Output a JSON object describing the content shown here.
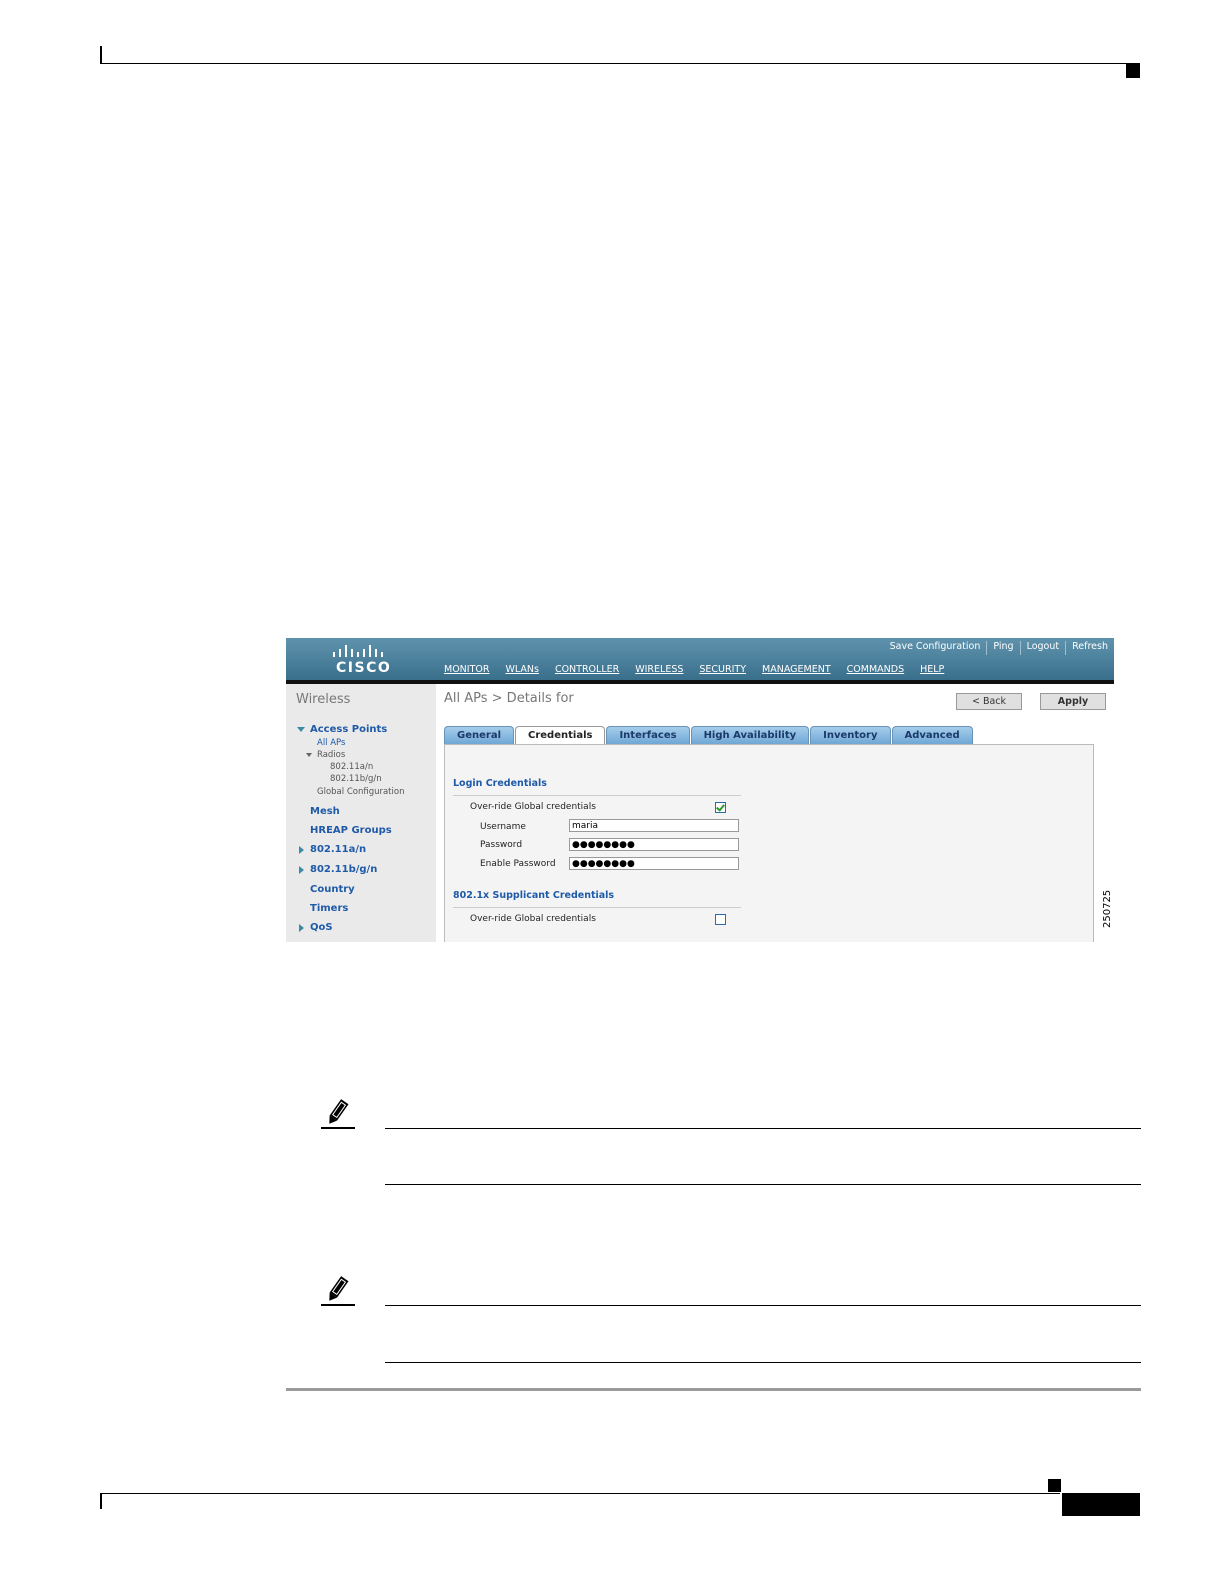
{
  "screenshot": {
    "logo_text": "CISCO",
    "top_links": [
      "Save Configuration",
      "Ping",
      "Logout",
      "Refresh"
    ],
    "menu": [
      "MONITOR",
      "WLANs",
      "CONTROLLER",
      "WIRELESS",
      "SECURITY",
      "MANAGEMENT",
      "COMMANDS",
      "HELP"
    ],
    "active_menu": "WIRELESS",
    "sidebar": {
      "title": "Wireless",
      "access_points": "Access Points",
      "all_aps": "All APs",
      "radios": "Radios",
      "radio_a": "802.11a/n",
      "radio_b": "802.11b/g/n",
      "global_config": "Global Configuration",
      "mesh": "Mesh",
      "hreap": "HREAP Groups",
      "band_a": "802.11a/n",
      "band_b": "802.11b/g/n",
      "country": "Country",
      "timers": "Timers",
      "qos": "QoS"
    },
    "page_title": "All APs > Details for",
    "back_button": "< Back",
    "apply_button": "Apply",
    "tabs": [
      "General",
      "Credentials",
      "Interfaces",
      "High Availability",
      "Inventory",
      "Advanced"
    ],
    "active_tab": "Credentials",
    "login_section": {
      "heading": "Login Credentials",
      "override_label": "Over-ride Global credentials",
      "override_checked": true,
      "username_label": "Username",
      "username_value": "maria",
      "password_label": "Password",
      "password_value": "●●●●●●●●",
      "enable_label": "Enable Password",
      "enable_value": "●●●●●●●●"
    },
    "supplicant_section": {
      "heading": "802.1x Supplicant Credentials",
      "override_label": "Over-ride Global credentials",
      "override_checked": false
    }
  },
  "figure_id": "250725",
  "colors": {
    "header_blue": "#4a7f9c",
    "link_blue": "#1e5aa8",
    "tab_blue": "#8bbbe1",
    "active_orange": "#f0a020"
  }
}
